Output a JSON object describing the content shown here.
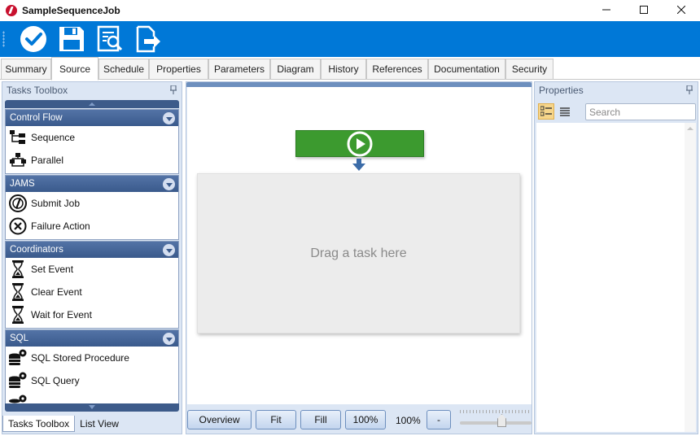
{
  "window": {
    "title": "SampleSequenceJob"
  },
  "toolbar": {
    "buttons": [
      {
        "icon": "checkmark-icon",
        "name": "save-and-close"
      },
      {
        "icon": "floppy-disk-icon",
        "name": "save"
      },
      {
        "icon": "document-search-icon",
        "name": "view-log"
      },
      {
        "icon": "export-icon",
        "name": "export"
      }
    ]
  },
  "tabs": [
    {
      "label": "Summary",
      "active": false
    },
    {
      "label": "Source",
      "active": true
    },
    {
      "label": "Schedule",
      "active": false
    },
    {
      "label": "Properties",
      "active": false
    },
    {
      "label": "Parameters",
      "active": false
    },
    {
      "label": "Diagram",
      "active": false
    },
    {
      "label": "History",
      "active": false
    },
    {
      "label": "References",
      "active": false
    },
    {
      "label": "Documentation",
      "active": false
    },
    {
      "label": "Security",
      "active": false
    }
  ],
  "toolbox": {
    "title": "Tasks Toolbox",
    "groups": [
      {
        "name": "Control Flow",
        "items": [
          {
            "label": "Sequence",
            "icon": "sequence-icon"
          },
          {
            "label": "Parallel",
            "icon": "parallel-icon"
          }
        ]
      },
      {
        "name": "JAMS",
        "items": [
          {
            "label": "Submit Job",
            "icon": "submit-job-icon"
          },
          {
            "label": "Failure Action",
            "icon": "failure-action-icon"
          }
        ]
      },
      {
        "name": "Coordinators",
        "items": [
          {
            "label": "Set Event",
            "icon": "hourglass-icon"
          },
          {
            "label": "Clear Event",
            "icon": "hourglass-icon"
          },
          {
            "label": "Wait for Event",
            "icon": "hourglass-icon"
          }
        ]
      },
      {
        "name": "SQL",
        "items": [
          {
            "label": "SQL Stored Procedure",
            "icon": "database-gear-icon"
          },
          {
            "label": "SQL Query",
            "icon": "database-gear-icon"
          }
        ]
      }
    ],
    "bottom_tabs": [
      {
        "label": "Tasks Toolbox",
        "active": true
      },
      {
        "label": "List View",
        "active": false
      }
    ]
  },
  "canvas": {
    "drop_zone_text": "Drag a task here",
    "zoom_buttons": [
      "Overview",
      "Fit",
      "Fill",
      "100%"
    ],
    "zoom_level": "100%",
    "zoom_out_label": "-",
    "zoom_slider_fraction": 0.53,
    "start_color": "#3c9a2f"
  },
  "properties": {
    "title": "Properties",
    "search_placeholder": "Search",
    "views": [
      "categorized-icon",
      "alphabetical-icon"
    ]
  },
  "colors": {
    "accent": "#0078d7",
    "panel_header": "#3a5a8c"
  }
}
